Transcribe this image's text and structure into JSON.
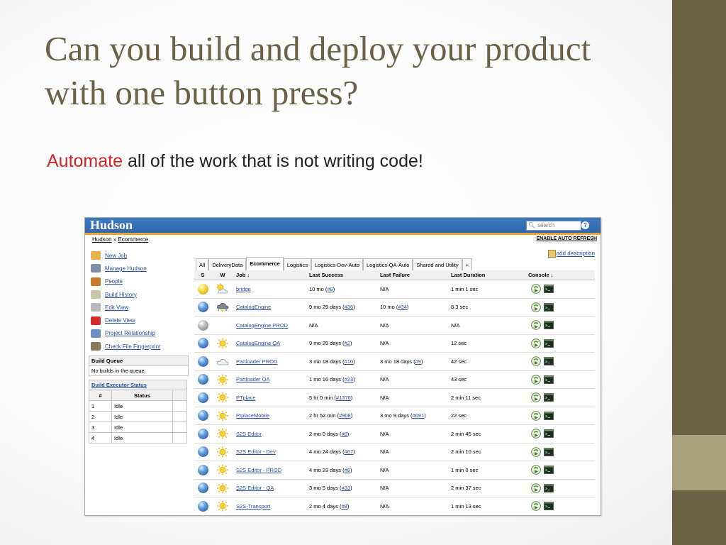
{
  "slide": {
    "title": "Can you build and deploy your product with one button press?",
    "subtitle_highlight": "Automate",
    "subtitle_rest": " all of the work that is not writing code!"
  },
  "header": {
    "logo": "Hudson",
    "search_placeholder": "search",
    "help": "?"
  },
  "breadcrumb": {
    "home": "Hudson",
    "sep": "»",
    "current": "Ecommerce"
  },
  "enable_auto_refresh": "ENABLE AUTO REFRESH",
  "add_description": "add description",
  "tasks": [
    {
      "label": "New Job",
      "icon": "new-job-icon",
      "color": "#e6b34a"
    },
    {
      "label": "Manage Hudson",
      "icon": "tools-icon",
      "color": "#7f8fa6"
    },
    {
      "label": "People",
      "icon": "people-icon",
      "color": "#c67a2a"
    },
    {
      "label": "Build History",
      "icon": "notepad-icon",
      "color": "#c9c5a6"
    },
    {
      "label": "Edit View",
      "icon": "gear-icon",
      "color": "#b9b9b9"
    },
    {
      "label": "Delete View",
      "icon": "no-entry-icon",
      "color": "#d12a2a"
    },
    {
      "label": "Project Relationship",
      "icon": "magnifier-icon",
      "color": "#6c8fbd"
    },
    {
      "label": "Check File Fingerprint",
      "icon": "fingerprint-icon",
      "color": "#8a7b5a"
    }
  ],
  "build_queue": {
    "title": "Build Queue",
    "message": "No builds in the queue."
  },
  "executors": {
    "title": "Build Executor Status",
    "headers": [
      "#",
      "Status"
    ],
    "rows": [
      [
        "1",
        "Idle"
      ],
      [
        "2",
        "Idle"
      ],
      [
        "3",
        "Idle"
      ],
      [
        "4",
        "Idle"
      ]
    ]
  },
  "tabs": [
    "All",
    "DeliveryData",
    "Ecommerce",
    "Logistics",
    "Logistics-Dev-Auto",
    "Logistics-QA-Auto",
    "Shared and Utility",
    "+"
  ],
  "active_tab": "Ecommerce",
  "columns": [
    "S",
    "W",
    "Job ↓",
    "Last Success",
    "Last Failure",
    "Last Duration",
    "Console ↓"
  ],
  "jobs": [
    {
      "status": "yellow",
      "weather": "partly-cloudy",
      "name": "bridge",
      "ls_pre": "10 mo (",
      "ls_link": "#8",
      "ls_post": ")",
      "lf_pre": "N/A",
      "lf_link": "",
      "lf_post": "",
      "duration": "1 min 1 sec"
    },
    {
      "status": "blue",
      "weather": "storm",
      "name": "CatalogEngine",
      "ls_pre": "9 mo 29 days (",
      "ls_link": "#36",
      "ls_post": ")",
      "lf_pre": "10 mo (",
      "lf_link": "#34",
      "lf_post": ")",
      "duration": "8.3 sec"
    },
    {
      "status": "grey",
      "weather": "none",
      "name": "CatalogEngine PROD",
      "ls_pre": "N/A",
      "ls_link": "",
      "ls_post": "",
      "lf_pre": "N/A",
      "lf_link": "",
      "lf_post": "",
      "duration": "N/A"
    },
    {
      "status": "blue",
      "weather": "sunny",
      "name": "CatalogEngine QA",
      "ls_pre": "9 mo 25 days (",
      "ls_link": "#2",
      "ls_post": ")",
      "lf_pre": "N/A",
      "lf_link": "",
      "lf_post": "",
      "duration": "12 sec"
    },
    {
      "status": "blue",
      "weather": "cloudy",
      "name": "Partloader PROD",
      "ls_pre": "3 mo 18 days (",
      "ls_link": "#10",
      "ls_post": ")",
      "lf_pre": "3 mo 18 days (",
      "lf_link": "#9",
      "lf_post": ")",
      "duration": "42 sec"
    },
    {
      "status": "blue",
      "weather": "sunny",
      "name": "Partloader QA",
      "ls_pre": "1 mo 16 days (",
      "ls_link": "#23",
      "ls_post": ")",
      "lf_pre": "N/A",
      "lf_link": "",
      "lf_post": "",
      "duration": "43 sec"
    },
    {
      "status": "blue",
      "weather": "sunny",
      "name": "PTplace",
      "ls_pre": "5 hr 0 min (",
      "ls_link": "#1376",
      "ls_post": ")",
      "lf_pre": "N/A",
      "lf_link": "",
      "lf_post": "",
      "duration": "2 min 11 sec"
    },
    {
      "status": "blue",
      "weather": "sunny",
      "name": "PtplaceMobile",
      "ls_pre": "2 hr 52 min (",
      "ls_link": "#908",
      "ls_post": ")",
      "lf_pre": "3 mo 9 days (",
      "lf_link": "#691",
      "lf_post": ")",
      "duration": "22 sec"
    },
    {
      "status": "blue",
      "weather": "sunny",
      "name": "S2S Editor",
      "ls_pre": "2 mo 0 days (",
      "ls_link": "#8",
      "ls_post": ")",
      "lf_pre": "N/A",
      "lf_link": "",
      "lf_post": "",
      "duration": "2 min 45 sec"
    },
    {
      "status": "blue",
      "weather": "sunny",
      "name": "S2S Editor - Dev",
      "ls_pre": "4 mo 24 days (",
      "ls_link": "#67",
      "ls_post": ")",
      "lf_pre": "N/A",
      "lf_link": "",
      "lf_post": "",
      "duration": "2 min 10 sec"
    },
    {
      "status": "blue",
      "weather": "sunny",
      "name": "S2S Editor - PROD",
      "ls_pre": "4 mo 23 days (",
      "ls_link": "#8",
      "ls_post": ")",
      "lf_pre": "N/A",
      "lf_link": "",
      "lf_post": "",
      "duration": "1 min 0 sec"
    },
    {
      "status": "blue",
      "weather": "sunny",
      "name": "S2S Editor - QA",
      "ls_pre": "3 mo 5 days (",
      "ls_link": "#33",
      "ls_post": ")",
      "lf_pre": "N/A",
      "lf_link": "",
      "lf_post": "",
      "duration": "2 min 37 sec"
    },
    {
      "status": "blue",
      "weather": "sunny",
      "name": "S2S-Transport",
      "ls_pre": "2 mo 4 days (",
      "ls_link": "#8",
      "ls_post": ")",
      "lf_pre": "N/A",
      "lf_link": "",
      "lf_post": "",
      "duration": "1 min 13 sec"
    }
  ],
  "colors": {
    "theme_dark": "#6b6146",
    "theme_light": "#a8a17b",
    "highlight_red": "#d22323",
    "hudson_header": "#2f67ad",
    "hudson_stripe": "#f4a332",
    "link": "#2a52a0"
  }
}
